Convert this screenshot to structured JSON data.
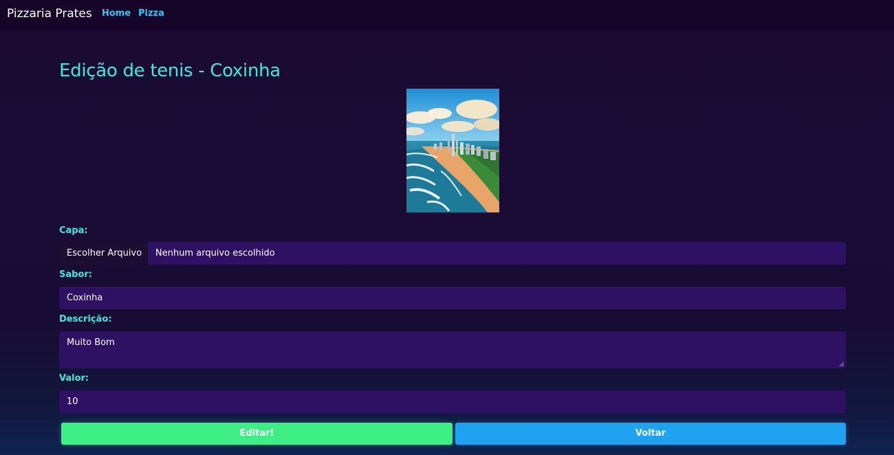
{
  "navbar": {
    "brand": "Pizzaria Prates",
    "links": [
      "Home",
      "Pizza"
    ]
  },
  "page": {
    "title": "Edição de tenis - Coxinha"
  },
  "form": {
    "capa": {
      "label": "Capa:",
      "button_label": "Escolher Arquivo",
      "status": "Nenhum arquivo escolhido"
    },
    "sabor": {
      "label": "Sabor:",
      "value": "Coxinha"
    },
    "descricao": {
      "label": "Descrição:",
      "value": "Muito Bom"
    },
    "valor": {
      "label": "Valor:",
      "value": "10"
    }
  },
  "actions": {
    "edit_label": "Editar!",
    "back_label": "Voltar"
  },
  "colors": {
    "accent": "#3fe8d8",
    "link": "#33c7f2",
    "field_bg": "#2e1162",
    "edit_button": "#3eef85",
    "back_button": "#1fa2f2"
  }
}
